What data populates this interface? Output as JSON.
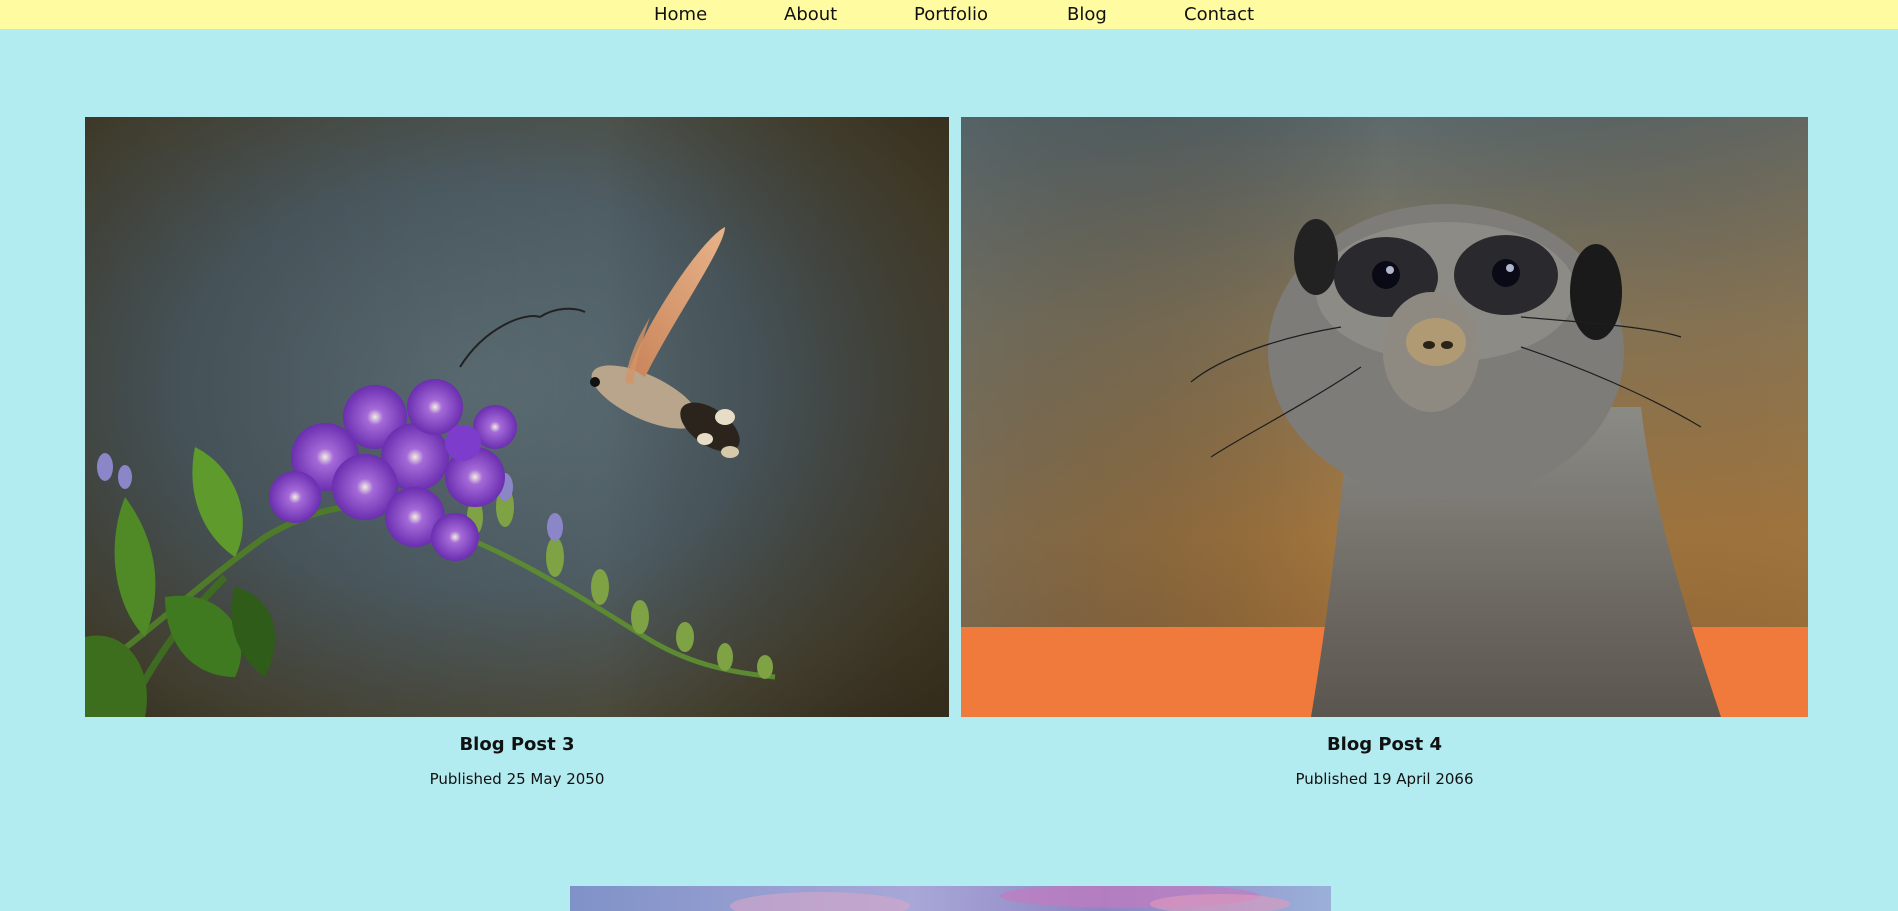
{
  "nav": {
    "items": [
      {
        "label": "Home"
      },
      {
        "label": "About"
      },
      {
        "label": "Portfolio"
      },
      {
        "label": "Blog"
      },
      {
        "label": "Contact"
      }
    ]
  },
  "posts": [
    {
      "title": "Blog Post 3",
      "date": "Published 25 May 2050",
      "image": "hummingbird-hawk-moth-flower-photo"
    },
    {
      "title": "Blog Post 4",
      "date": "Published 19 April 2066",
      "image": "meerkat-portrait-photo"
    },
    {
      "image": "sky-clouds-photo"
    }
  ],
  "colors": {
    "page_background": "#b3ecf0",
    "nav_background": "#fffba1",
    "text": "#111111"
  }
}
